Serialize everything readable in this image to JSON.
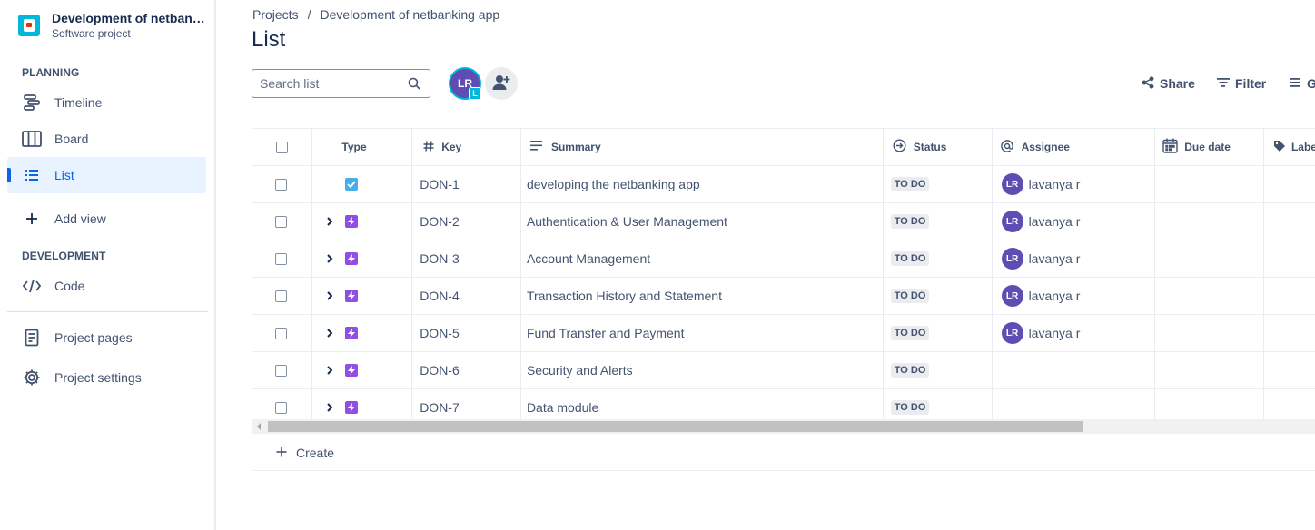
{
  "project": {
    "name": "Development of netban…",
    "type": "Software project"
  },
  "sidebar": {
    "planning_title": "PLANNING",
    "items": [
      {
        "label": "Timeline",
        "icon": "timeline-icon"
      },
      {
        "label": "Board",
        "icon": "board-icon"
      },
      {
        "label": "List",
        "icon": "list-icon",
        "active": true
      },
      {
        "label": "Add view",
        "icon": "plus-icon"
      }
    ],
    "development_title": "DEVELOPMENT",
    "dev_items": [
      {
        "label": "Code",
        "icon": "code-icon"
      }
    ],
    "bottom_items": [
      {
        "label": "Project pages",
        "icon": "page-icon"
      },
      {
        "label": "Project settings",
        "icon": "gear-icon"
      }
    ]
  },
  "breadcrumb": {
    "root": "Projects",
    "separator": "/",
    "current": "Development of netbanking app"
  },
  "page": {
    "title": "List"
  },
  "search": {
    "placeholder": "Search list"
  },
  "people": {
    "avatar_initials": "LR",
    "badge": "L"
  },
  "toolbar": {
    "share": "Share",
    "filter": "Filter",
    "group": "G"
  },
  "table": {
    "columns": {
      "type": "Type",
      "key": "Key",
      "summary": "Summary",
      "status": "Status",
      "assignee": "Assignee",
      "due_date": "Due date",
      "labels": "Labe"
    },
    "rows": [
      {
        "type": "task",
        "expandable": false,
        "key": "DON-1",
        "summary": "developing the netbanking app",
        "status": "TO DO",
        "assignee": "lavanya r",
        "assignee_initials": "LR"
      },
      {
        "type": "epic",
        "expandable": true,
        "key": "DON-2",
        "summary": "Authentication & User Management",
        "status": "TO DO",
        "assignee": "lavanya r",
        "assignee_initials": "LR"
      },
      {
        "type": "epic",
        "expandable": true,
        "key": "DON-3",
        "summary": "Account Management",
        "status": "TO DO",
        "assignee": "lavanya r",
        "assignee_initials": "LR"
      },
      {
        "type": "epic",
        "expandable": true,
        "key": "DON-4",
        "summary": "Transaction History and Statement",
        "status": "TO DO",
        "assignee": "lavanya r",
        "assignee_initials": "LR"
      },
      {
        "type": "epic",
        "expandable": true,
        "key": "DON-5",
        "summary": "Fund Transfer and Payment",
        "status": "TO DO",
        "assignee": "lavanya r",
        "assignee_initials": "LR"
      },
      {
        "type": "epic",
        "expandable": true,
        "key": "DON-6",
        "summary": "Security and Alerts",
        "status": "TO DO",
        "assignee": "",
        "assignee_initials": ""
      },
      {
        "type": "epic",
        "expandable": true,
        "key": "DON-7",
        "summary": "Data module",
        "status": "TO DO",
        "assignee": "",
        "assignee_initials": ""
      }
    ],
    "create_label": "Create"
  },
  "colors": {
    "accent": "#0c66e4",
    "epic": "#904ee2",
    "task": "#4bade8",
    "avatar": "#5e4db2"
  }
}
